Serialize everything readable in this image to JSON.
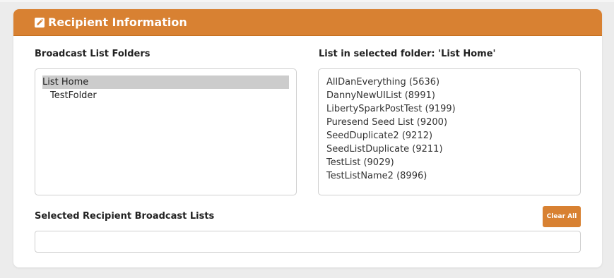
{
  "colors": {
    "accent": "#d88132",
    "page_background": "#ececec",
    "panel_background": "#ffffff",
    "selected_row": "#cccccc"
  },
  "panel": {
    "title": "Recipient Information",
    "icon": "edit-icon"
  },
  "folders": {
    "label": "Broadcast List Folders",
    "items": [
      {
        "label": "List Home",
        "selected": true
      },
      {
        "label": "TestFolder",
        "selected": false
      }
    ]
  },
  "lists": {
    "label": "List in selected folder: 'List Home'",
    "items": [
      "AllDanEverything (5636)",
      "DannyNewUIList (8991)",
      "LibertySparkPostTest (9199)",
      "Puresend Seed List (9200)",
      "SeedDuplicate2 (9212)",
      "SeedListDuplicate (9211)",
      "TestList (9029)",
      "TestListName2 (8996)"
    ]
  },
  "selected_lists": {
    "label": "Selected Recipient Broadcast Lists",
    "value": "",
    "clear_label": "Clear All"
  }
}
